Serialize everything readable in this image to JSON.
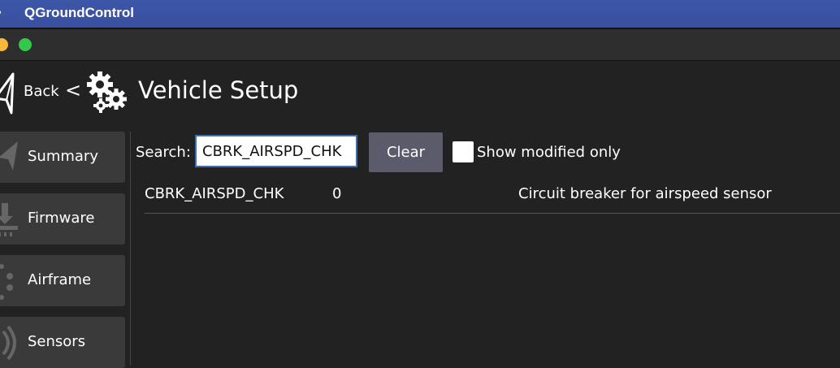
{
  "menubar": {
    "app_name": "QGroundControl"
  },
  "toolbar": {
    "back_label": "Back",
    "chevron": "<",
    "title": "Vehicle Setup"
  },
  "sidebar": {
    "items": [
      {
        "label": "Summary",
        "icon": "paper-plane-icon"
      },
      {
        "label": "Firmware",
        "icon": "download-icon"
      },
      {
        "label": "Airframe",
        "icon": "airframe-dots-icon"
      },
      {
        "label": "Sensors",
        "icon": "radio-waves-icon"
      }
    ]
  },
  "search": {
    "label": "Search:",
    "value": "CBRK_AIRSPD_CHK",
    "clear_label": "Clear",
    "show_modified_label": "Show modified only",
    "show_modified_checked": false
  },
  "params": [
    {
      "name": "CBRK_AIRSPD_CHK",
      "value": "0",
      "description": "Circuit breaker for airspeed sensor"
    }
  ],
  "colors": {
    "menubar": "#3a4fa0",
    "background": "#222222",
    "sidebar_button": "#3a3a3a",
    "clear_button": "#5b5b6b",
    "input_border": "#3d6fb5"
  }
}
